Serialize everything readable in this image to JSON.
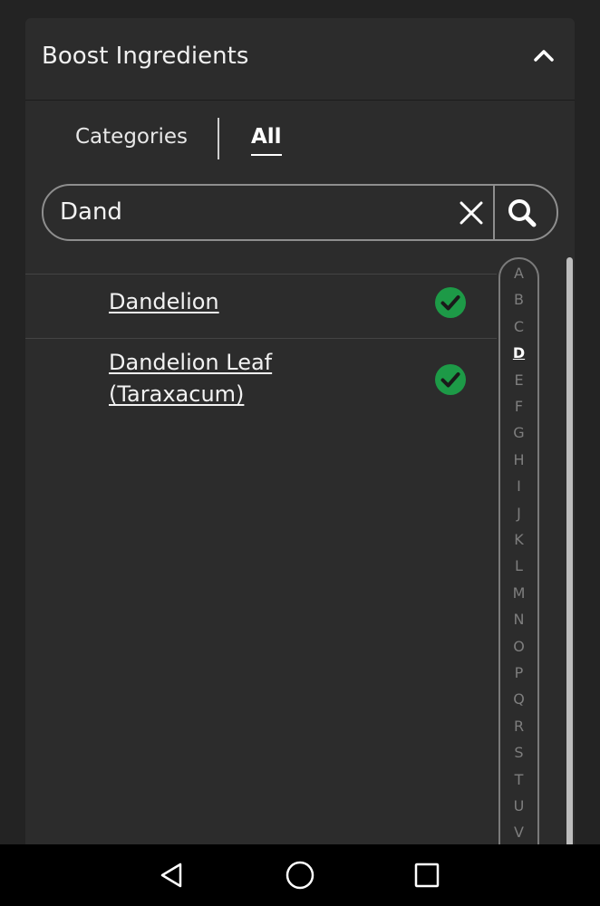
{
  "panel": {
    "title": "Boost Ingredients",
    "collapse_icon": "chevron-up-icon"
  },
  "tabs": [
    {
      "label": "Categories",
      "active": false
    },
    {
      "label": "All",
      "active": true
    }
  ],
  "search": {
    "value": "Dand",
    "clear_icon": "close-icon",
    "search_icon": "search-icon"
  },
  "results": [
    {
      "name": "Dandelion",
      "selected": true,
      "status_icon": "check-circle-icon"
    },
    {
      "name": "Dandelion Leaf (Taraxacum)",
      "selected": true,
      "status_icon": "check-circle-icon"
    }
  ],
  "alpha_index": {
    "letters": [
      "A",
      "B",
      "C",
      "D",
      "E",
      "F",
      "G",
      "H",
      "I",
      "J",
      "K",
      "L",
      "M",
      "N",
      "O",
      "P",
      "Q",
      "R",
      "S",
      "T",
      "U",
      "V"
    ],
    "active": "D"
  },
  "colors": {
    "background": "#232323",
    "panel": "#2c2c2c",
    "check_green": "#1d9a47",
    "index_inactive": "#7e7e7e"
  },
  "nav_bar": {
    "back_icon": "back-triangle-icon",
    "home_icon": "home-circle-icon",
    "recents_icon": "recents-square-icon"
  }
}
